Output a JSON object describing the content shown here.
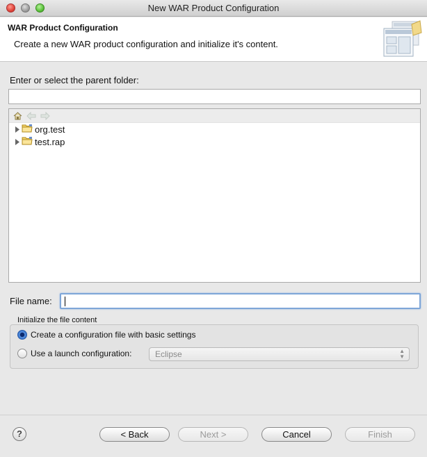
{
  "window": {
    "title": "New WAR Product Configuration"
  },
  "banner": {
    "title": "WAR Product Configuration",
    "description": "Create a new WAR product configuration and initialize it's content."
  },
  "parent_folder": {
    "label": "Enter or select the parent folder:",
    "value": ""
  },
  "tree": {
    "toolbar": [
      "home-icon",
      "back-arrow-icon",
      "forward-arrow-icon"
    ],
    "items": [
      {
        "label": "org.test",
        "icon": "folder-icon"
      },
      {
        "label": "test.rap",
        "icon": "folder-icon"
      }
    ]
  },
  "file_name": {
    "label": "File name:",
    "value": ""
  },
  "init_group": {
    "legend": "Initialize the file content",
    "option_basic": "Create a configuration file with basic settings",
    "option_launch": "Use a launch configuration:",
    "launch_value": "Eclipse",
    "selected": "option_basic"
  },
  "buttons": {
    "help": "?",
    "back": "< Back",
    "next": "Next >",
    "cancel": "Cancel",
    "finish": "Finish"
  }
}
